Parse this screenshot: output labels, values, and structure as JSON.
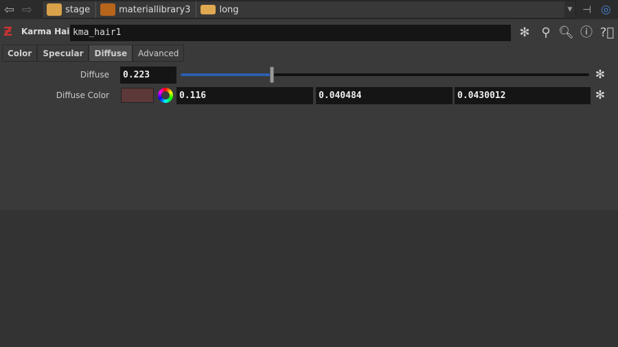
{
  "breadcrumb": [
    {
      "label": "stage",
      "icon": "stage-icon"
    },
    {
      "label": "materiallibrary3",
      "icon": "material-library-icon"
    },
    {
      "label": "long",
      "icon": "box-icon"
    }
  ],
  "node": {
    "type": "Karma Hair",
    "name": "kma_hair1"
  },
  "tabs": [
    "Color",
    "Specular",
    "Diffuse",
    "Advanced"
  ],
  "active_tab": "Diffuse",
  "params": {
    "diffuse": {
      "label": "Diffuse",
      "value": "0.223",
      "slider_fraction": 0.223
    },
    "diffuse_color": {
      "label": "Diffuse Color",
      "swatch": "#5c3838",
      "r": "0.116",
      "g": "0.040484",
      "b": "0.0430012"
    }
  },
  "colors": {
    "accent": "#2a5fb0"
  }
}
